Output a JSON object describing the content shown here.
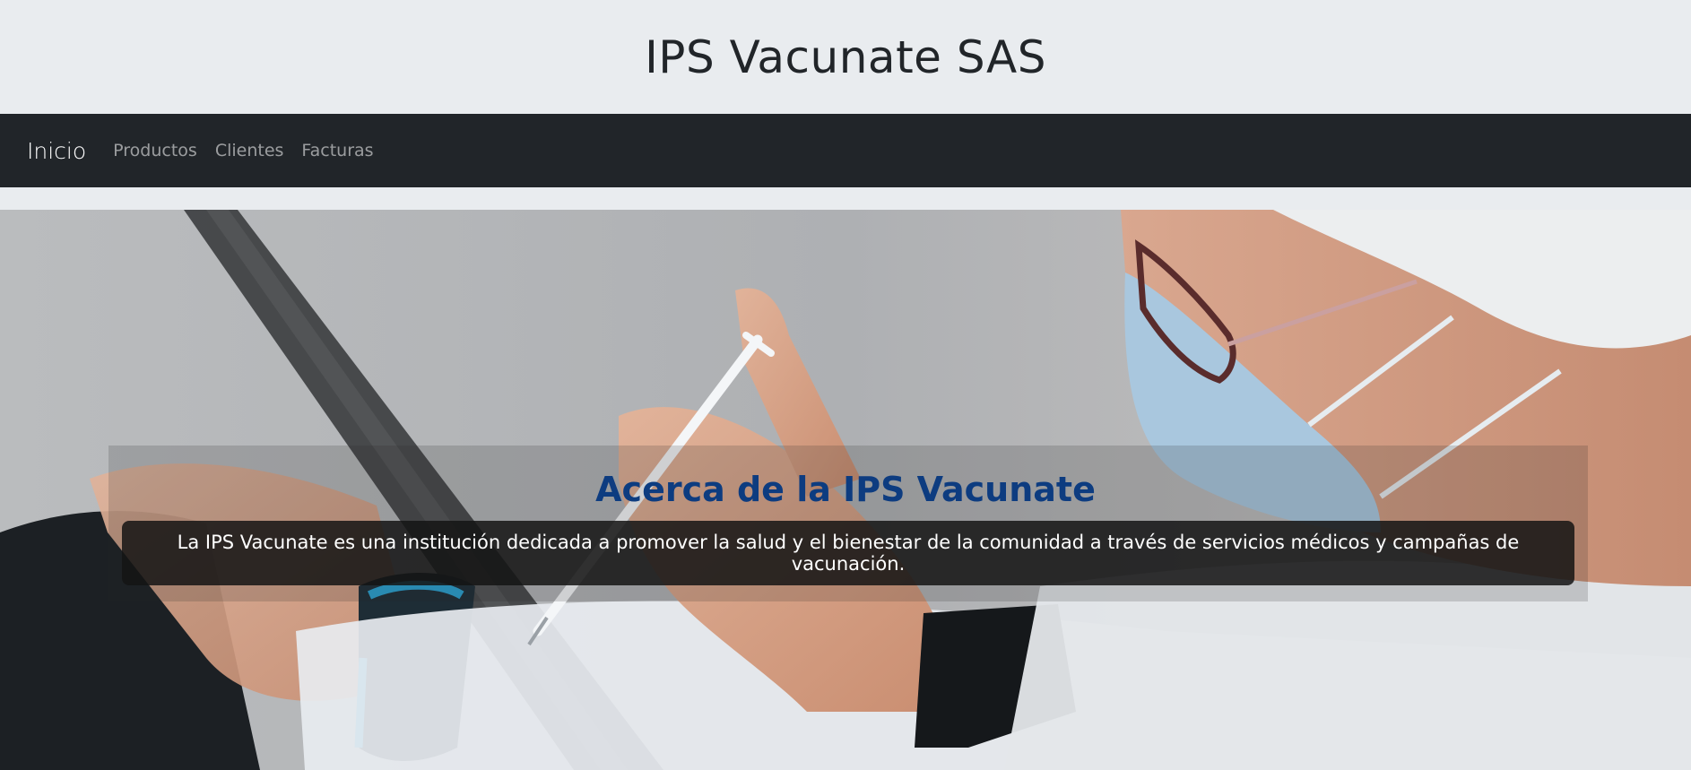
{
  "header": {
    "title": "IPS Vacunate SAS"
  },
  "navbar": {
    "brand": "Inicio",
    "links": [
      "Productos",
      "Clientes",
      "Facturas"
    ]
  },
  "hero": {
    "heading": "Acerca de la IPS Vacunate",
    "text": "La IPS Vacunate es una institución dedicada a promover la salud y el bienestar de la comunidad a través de servicios médicos y campañas de vacunación.",
    "image": "photo of health worker in mask and hair net holding a syringe over a patient's arm"
  },
  "colors": {
    "header_bg": "#e9ecef",
    "navbar_bg": "#212529",
    "heading": "#0d3c80"
  }
}
